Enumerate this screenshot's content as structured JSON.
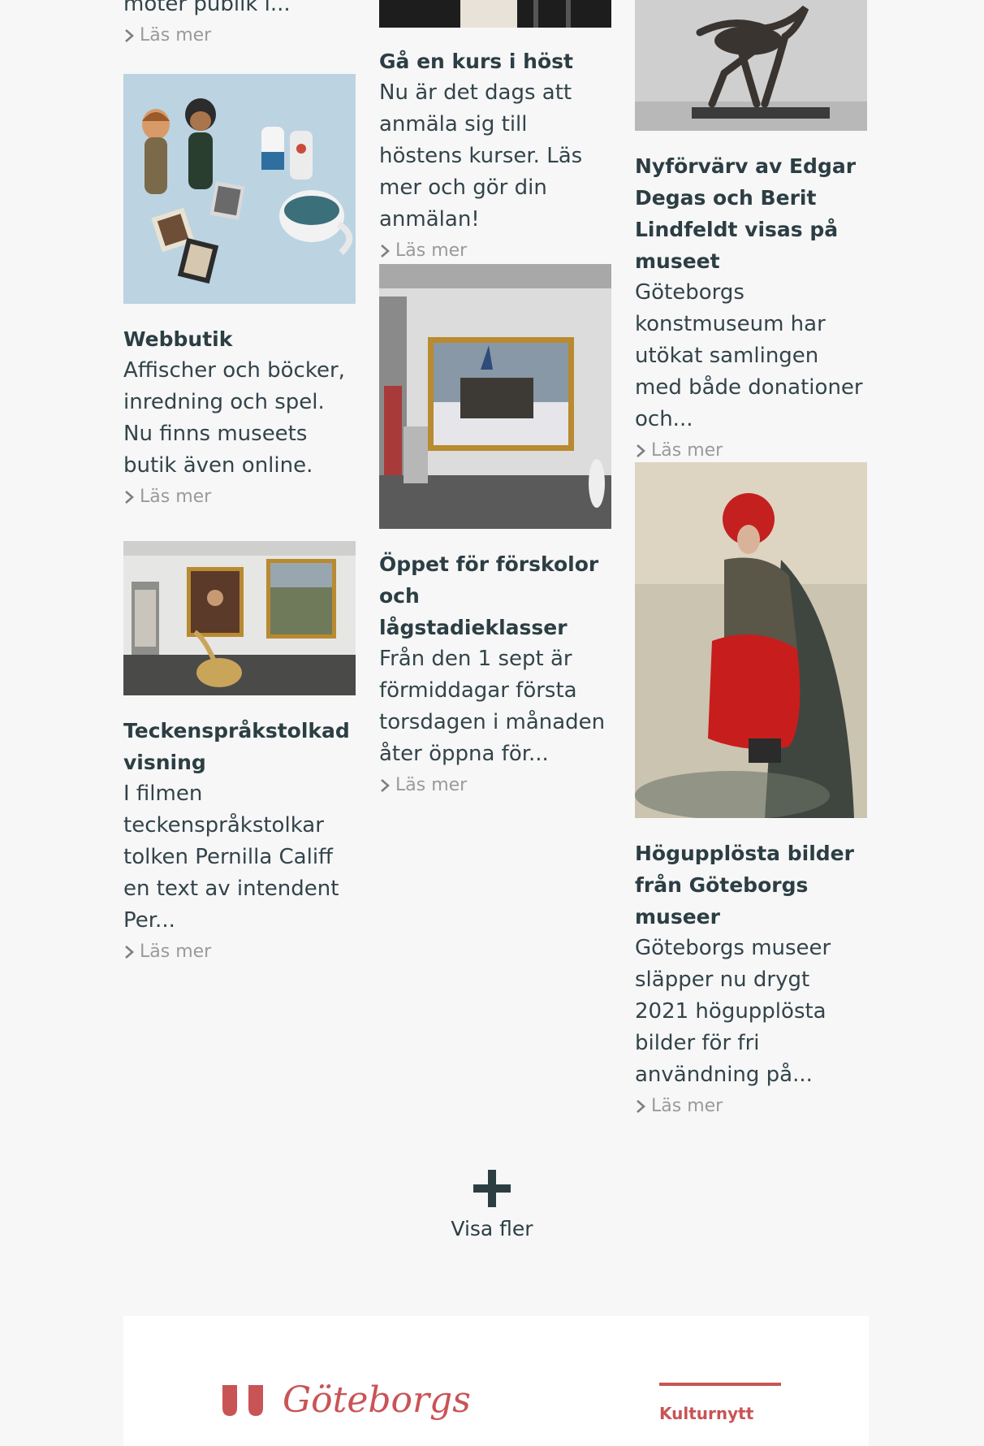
{
  "read_more": "Läs mer",
  "col1": {
    "top_excerpt_tail": "möter publik i...",
    "cards": [
      {
        "title": "Webbutik",
        "excerpt": "Affischer och böcker, inredning och spel. Nu finns museets butik även online."
      },
      {
        "title": "Teckenspråkstolkad visning",
        "excerpt": "I filmen teckenspråkstolkar tolken Pernilla Califf en text av intendent Per..."
      }
    ]
  },
  "col2": {
    "cards": [
      {
        "title": "Gå en kurs i höst",
        "excerpt": "Nu är det dags att anmäla sig till höstens kurser. Läs mer och gör din anmälan!"
      },
      {
        "title": "Öppet för förskolor och lågstadieklasser",
        "excerpt": "Från den 1 sept är förmiddagar första torsdagen i månaden åter öppna för..."
      }
    ]
  },
  "col3": {
    "cards": [
      {
        "title": "Nyförvärv av Edgar Degas och Berit Lindfeldt visas på museet",
        "excerpt": "Göteborgs konstmuseum har utökat samlingen med både donationer och..."
      },
      {
        "title": "Högupplösta bilder från Göteborgs museer",
        "excerpt": "Göteborgs museer släpper nu drygt 2021 högupplösta bilder för fri användning på..."
      }
    ]
  },
  "load_more": {
    "label": "Visa fler"
  },
  "footer": {
    "logo_text": "Göteborgs",
    "link": "Kulturnytt"
  },
  "colors": {
    "accent": "#c85456",
    "text": "#2c3e44",
    "muted": "#9a9a9a",
    "background": "#f7f7f7"
  }
}
